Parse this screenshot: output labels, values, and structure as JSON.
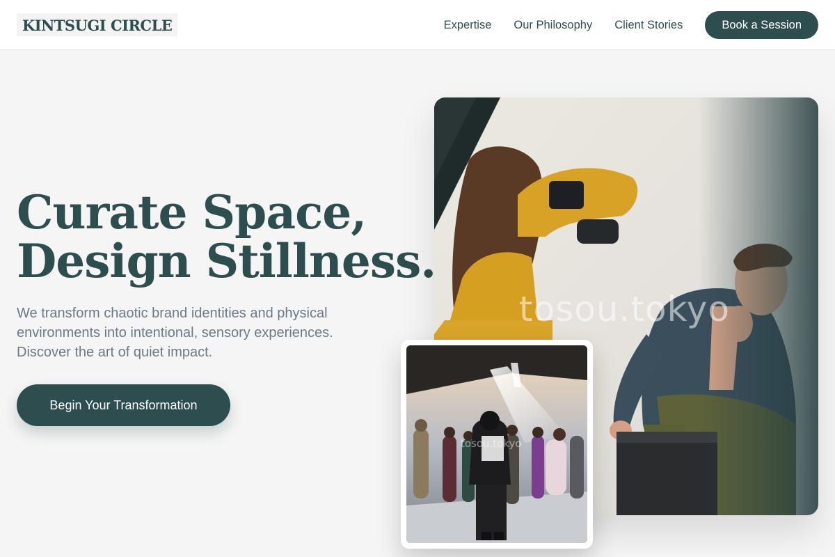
{
  "header": {
    "logo": "KINTSUGI CIRCLE",
    "nav": [
      {
        "label": "Expertise"
      },
      {
        "label": "Our Philosophy"
      },
      {
        "label": "Client Stories"
      }
    ],
    "cta_label": "Book a Session"
  },
  "hero": {
    "title_line1": "Curate Space,",
    "title_line2": "Design Stillness.",
    "description": "We transform chaotic brand identities and physical environments into intentional, sensory experiences. Discover the art of quiet impact.",
    "cta_label": "Begin Your Transformation"
  },
  "images": {
    "main_watermark": "tosou.tokyo",
    "inset_watermark": "tosou.tokyo"
  },
  "colors": {
    "brand": "#2e4d4f",
    "background": "#f5f5f5",
    "muted_text": "#6b7a88"
  }
}
